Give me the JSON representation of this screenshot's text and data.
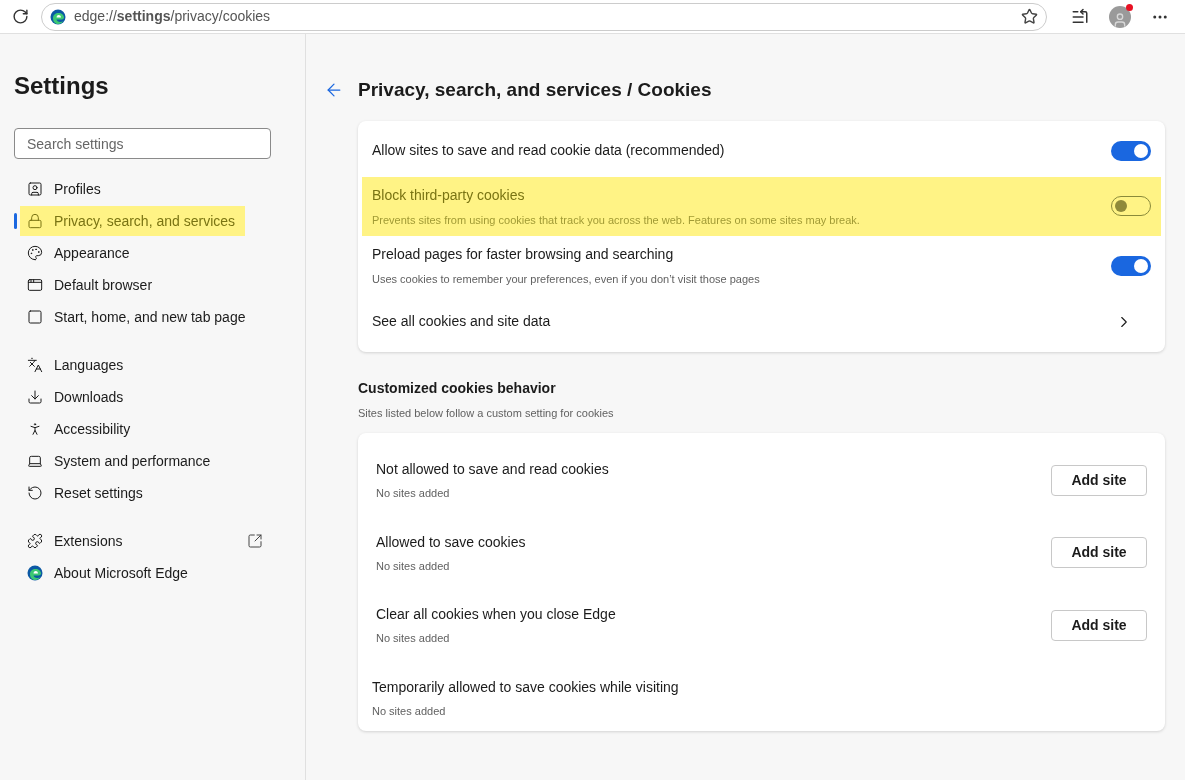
{
  "toolbar": {
    "url": "edge://**settings**/privacy/cookies"
  },
  "sidebar": {
    "title": "Settings",
    "search": {
      "placeholder": "Search settings"
    },
    "groups": [
      [
        {
          "label": "Profiles",
          "selected": false,
          "highlighted": false
        },
        {
          "label": "Privacy, search, and services",
          "selected": true,
          "highlighted": true
        },
        {
          "label": "Appearance",
          "selected": false,
          "highlighted": false
        },
        {
          "label": "Default browser",
          "selected": false,
          "highlighted": false
        },
        {
          "label": "Start, home, and new tab page",
          "selected": false,
          "highlighted": false
        }
      ],
      [
        {
          "label": "Languages",
          "selected": false,
          "highlighted": false
        },
        {
          "label": "Downloads",
          "selected": false,
          "highlighted": false
        },
        {
          "label": "Accessibility",
          "selected": false,
          "highlighted": false
        },
        {
          "label": "System and performance",
          "selected": false,
          "highlighted": false
        },
        {
          "label": "Reset settings",
          "selected": false,
          "highlighted": false
        }
      ],
      [
        {
          "label": "Extensions",
          "selected": false,
          "highlighted": false,
          "external": true
        },
        {
          "label": "About Microsoft Edge",
          "selected": false,
          "highlighted": false,
          "external": false
        }
      ]
    ]
  },
  "page": {
    "title": "Privacy, search, and services / Cookies",
    "settings": [
      {
        "kind": "toggle",
        "label": "Allow sites to save and read cookie data (recommended)",
        "on": true,
        "highlighted": false
      },
      {
        "kind": "toggle",
        "label": "Block third-party cookies",
        "description": "Prevents sites from using cookies that track you across the web. Features on some sites may break.",
        "on": false,
        "highlighted": true
      },
      {
        "kind": "toggle",
        "label": "Preload pages for faster browsing and searching",
        "description": "Uses cookies to remember your preferences, even if you don’t visit those pages",
        "on": true,
        "highlighted": false
      },
      {
        "kind": "link",
        "label": "See all cookies and site data",
        "highlighted": false
      }
    ],
    "custom": {
      "title": "Customized cookies behavior",
      "subtitle": "Sites listed below follow a custom setting for cookies",
      "rows": [
        {
          "label": "Not allowed to save and read cookies",
          "status": "No sites added",
          "button": "Add site"
        },
        {
          "label": "Allowed to save cookies",
          "status": "No sites added",
          "button": "Add site"
        },
        {
          "label": "Clear all cookies when you close Edge",
          "status": "No sites added",
          "button": "Add site"
        },
        {
          "label": "Temporarily allowed to save cookies while visiting",
          "status": "No sites added"
        }
      ]
    }
  }
}
